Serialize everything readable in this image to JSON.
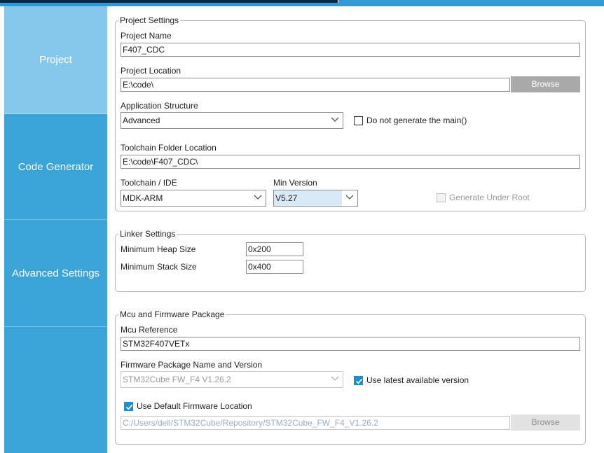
{
  "sidebar": {
    "tabs": [
      {
        "label": "Project",
        "active": true
      },
      {
        "label": "Code Generator",
        "active": false
      },
      {
        "label": "Advanced Settings",
        "active": false
      }
    ]
  },
  "project_settings": {
    "legend": "Project Settings",
    "name_label": "Project Name",
    "name_value": "F407_CDC",
    "location_label": "Project Location",
    "location_value": "E:\\code\\",
    "browse_label": "Browse",
    "structure_label": "Application Structure",
    "structure_value": "Advanced",
    "no_main_label": "Do not generate the main()",
    "toolchain_folder_label": "Toolchain Folder Location",
    "toolchain_folder_value": "E:\\code\\F407_CDC\\",
    "toolchain_label": "Toolchain / IDE",
    "toolchain_value": "MDK-ARM",
    "min_version_label": "Min Version",
    "min_version_value": "V5.27",
    "under_root_label": "Generate Under Root"
  },
  "linker_settings": {
    "legend": "Linker Settings",
    "heap_label": "Minimum Heap Size",
    "heap_value": "0x200",
    "stack_label": "Minimum Stack Size",
    "stack_value": "0x400"
  },
  "mcu_firmware": {
    "legend": "Mcu and Firmware Package",
    "mcu_label": "Mcu Reference",
    "mcu_value": "STM32F407VETx",
    "fw_label": "Firmware Package Name and Version",
    "fw_value": "STM32Cube FW_F4 V1.26.2",
    "use_latest_label": "Use latest available version",
    "use_default_label": "Use Default Firmware Location",
    "fw_location_value": "C:/Users/dell/STM32Cube/Repository/STM32Cube_FW_F4_V1.26.2",
    "browse_label": "Browse"
  },
  "colors": {
    "sidebar": "#3aa4d9",
    "sidebar_active": "#86c8ec",
    "checkbox_checked": "#1b8fd2",
    "button": "#a9a9a9"
  },
  "icons": {
    "dropdown": "chevron-down-icon",
    "checked": "check-icon"
  }
}
